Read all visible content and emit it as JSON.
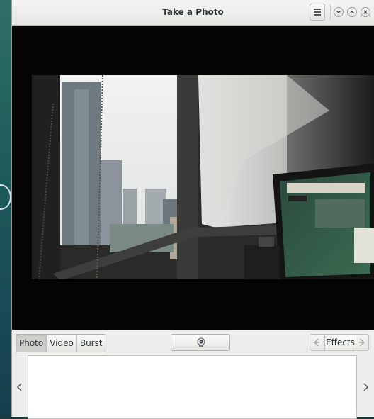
{
  "window": {
    "title": "Take a Photo"
  },
  "modes": {
    "photo": "Photo",
    "video": "Video",
    "burst": "Burst",
    "active": "Photo"
  },
  "effects": {
    "label": "Effects"
  },
  "icons": {
    "menu": "hamburger-icon",
    "minimize": "minimize-icon",
    "maximize": "maximize-icon",
    "close": "close-icon",
    "shutter": "camera-icon",
    "prev_effect": "arrow-left-icon",
    "next_effect": "arrow-right-icon",
    "gallery_prev": "chevron-left-icon",
    "gallery_next": "chevron-right-icon"
  }
}
